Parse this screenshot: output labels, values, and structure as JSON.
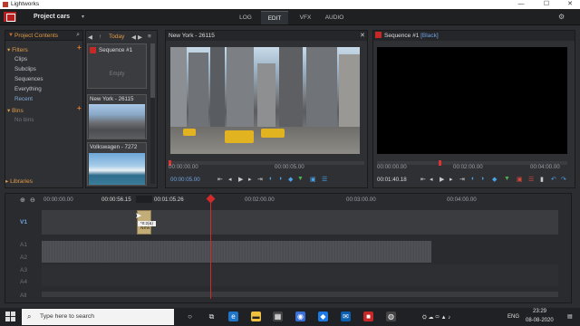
{
  "window": {
    "title": "Lightworks",
    "minimize": "—",
    "maximize": "☐",
    "close": "✕"
  },
  "app": {
    "project_title": "Project cars",
    "project_caret": "▾",
    "tabs": [
      {
        "label": "LOG",
        "active": false
      },
      {
        "label": "EDIT",
        "active": true
      },
      {
        "label": "VFX",
        "active": false
      },
      {
        "label": "AUDIO",
        "active": false
      }
    ],
    "settings_icon": "gear-icon"
  },
  "project_contents": {
    "header": "Project Contents",
    "filters_label": "Filters",
    "filters": [
      "Clips",
      "Subclips",
      "Sequences",
      "Everything",
      "Recent"
    ],
    "bins_label": "Bins",
    "bins_empty": "No bins",
    "libraries_label": "Libraries"
  },
  "browser": {
    "nav_back": "◀",
    "nav_up": "↑",
    "today_label": "Today",
    "nav_prev": "◀",
    "nav_next": "▶",
    "sequence_card": {
      "name": "Sequence #1",
      "empty": "Empty"
    },
    "clips": [
      {
        "name": "New York - 26115"
      },
      {
        "name": "Volkswagen - 7272"
      }
    ]
  },
  "source_viewer": {
    "title": "New York - 26115",
    "close": "✕",
    "ruler_start": "00:00:00.00",
    "ruler_mid": "00:00:05.00",
    "timecode": "00:00:05.00"
  },
  "record_viewer": {
    "title": "Sequence #1",
    "subtitle": "[Black]",
    "ruler_start": "00:00:00.00",
    "ruler_mid": "00:02:00.00",
    "ruler_end": "00:04:00.00",
    "timecode": "00:01:40.18"
  },
  "timeline": {
    "ruler": [
      "00:00:00.00",
      "00:00:56.15",
      "00:01:05.26",
      "00:02:00.00",
      "00:03:00.00",
      "00:04:00.00"
    ],
    "tracks": [
      "V1",
      "A1",
      "A2",
      "A3",
      "A4",
      "All"
    ],
    "tooltip": "*0:2(&)",
    "drop_clip_label": "New"
  },
  "taskbar": {
    "search_placeholder": "Type here to search",
    "language": "ENG",
    "time": "23:29",
    "date": "08-08-2020"
  }
}
